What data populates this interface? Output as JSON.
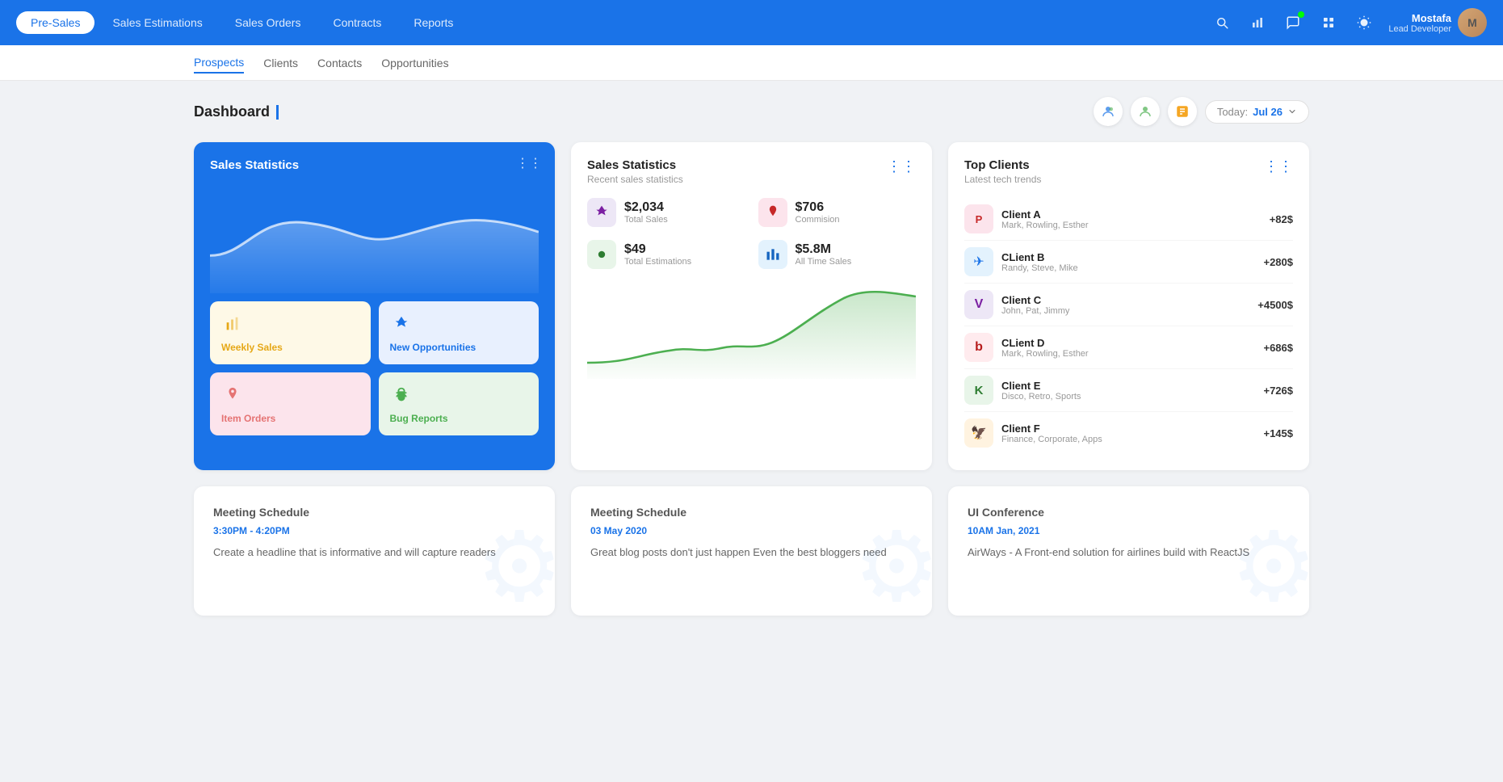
{
  "nav": {
    "tabs": [
      {
        "label": "Pre-Sales",
        "active": true
      },
      {
        "label": "Sales Estimations",
        "active": false
      },
      {
        "label": "Sales Orders",
        "active": false
      },
      {
        "label": "Contracts",
        "active": false
      },
      {
        "label": "Reports",
        "active": false
      }
    ],
    "icons": [
      "search",
      "bar-chart",
      "message",
      "grid",
      "sun"
    ],
    "user": {
      "name": "Mostafa",
      "role": "Lead Developer",
      "initials": "M"
    }
  },
  "subnav": {
    "items": [
      {
        "label": "Prospects",
        "active": true
      },
      {
        "label": "Clients",
        "active": false
      },
      {
        "label": "Contacts",
        "active": false
      },
      {
        "label": "Opportunities",
        "active": false
      }
    ]
  },
  "dashboard": {
    "title": "Dashboard",
    "date_label": "Today:",
    "date_value": "Jul 26"
  },
  "sales_stats_card": {
    "title": "Sales Statistics",
    "mini_cards": [
      {
        "label": "Weekly Sales",
        "variant": "yellow"
      },
      {
        "label": "New Opportunities",
        "variant": "light-blue"
      },
      {
        "label": "Item Orders",
        "variant": "pink"
      },
      {
        "label": "Bug Reports",
        "variant": "green"
      }
    ]
  },
  "stats_detail": {
    "title": "Sales Statistics",
    "subtitle": "Recent sales statistics",
    "stats": [
      {
        "value": "$2,034",
        "label": "Total Sales",
        "icon_variant": "purple"
      },
      {
        "value": "$706",
        "label": "Commision",
        "icon_variant": "pink"
      },
      {
        "value": "$49",
        "label": "Total Estimations",
        "icon_variant": "green"
      },
      {
        "value": "$5.8M",
        "label": "All Time Sales",
        "icon_variant": "blue"
      }
    ]
  },
  "top_clients": {
    "title": "Top Clients",
    "subtitle": "Latest tech trends",
    "clients": [
      {
        "name": "Client A",
        "members": "Mark, Rowling, Esther",
        "value": "+82$",
        "logo_variant": "red",
        "emoji": "🅟"
      },
      {
        "name": "CLient B",
        "members": "Randy, Steve, Mike",
        "value": "+280$",
        "logo_variant": "blue",
        "emoji": "✈"
      },
      {
        "name": "Client C",
        "members": "John, Pat, Jimmy",
        "value": "+4500$",
        "logo_variant": "purple",
        "emoji": "✔"
      },
      {
        "name": "CLient D",
        "members": "Mark, Rowling, Esther",
        "value": "+686$",
        "logo_variant": "red2",
        "emoji": "b"
      },
      {
        "name": "Client E",
        "members": "Disco, Retro, Sports",
        "value": "+726$",
        "logo_variant": "green",
        "emoji": "K"
      },
      {
        "name": "Client F",
        "members": "Finance, Corporate, Apps",
        "value": "+145$",
        "logo_variant": "orange",
        "emoji": "🦅"
      }
    ]
  },
  "meetings": [
    {
      "title": "Meeting Schedule",
      "date": "3:30PM - 4:20PM",
      "text": "Create a headline that is informative and will capture readers"
    },
    {
      "title": "Meeting Schedule",
      "date": "03 May 2020",
      "text": "Great blog posts don't just happen Even the best bloggers need"
    },
    {
      "title": "UI Conference",
      "date": "10AM Jan, 2021",
      "text": "AirWays - A Front-end solution for airlines build with ReactJS"
    }
  ]
}
